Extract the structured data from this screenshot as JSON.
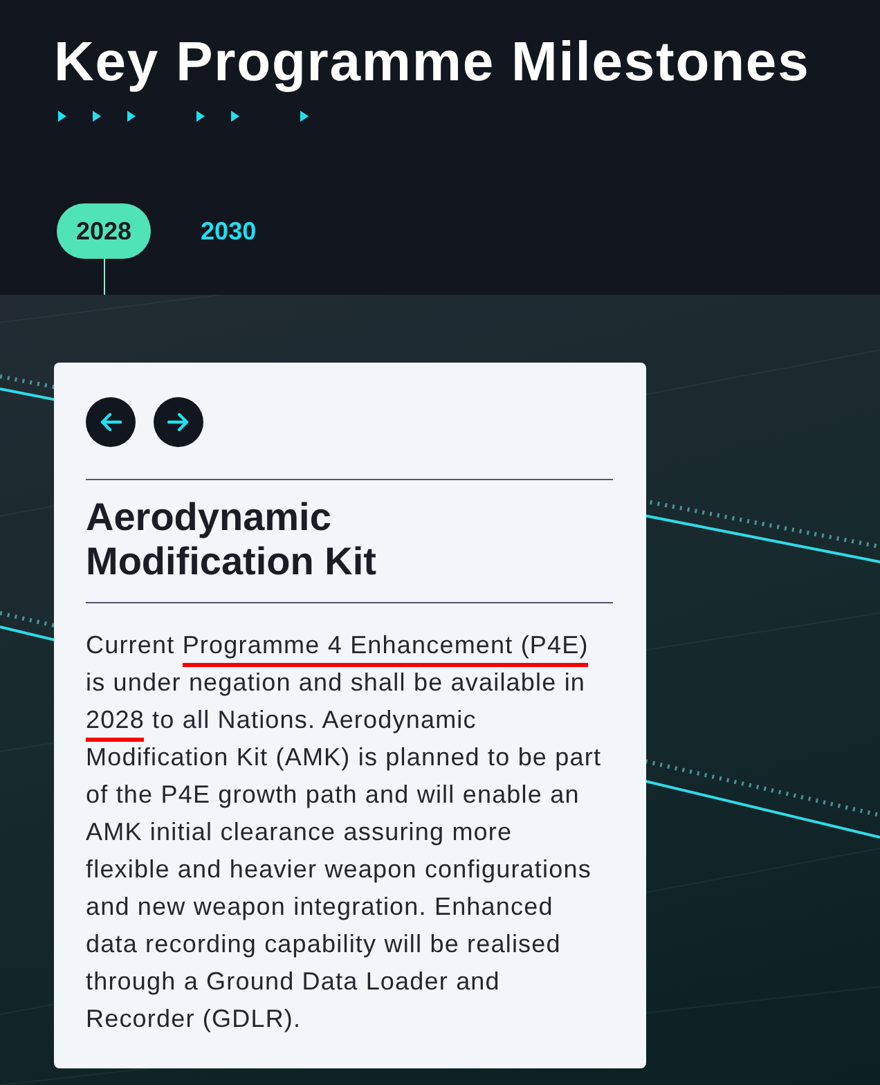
{
  "header": {
    "title": "Key Programme Milestones"
  },
  "timeline": {
    "years": [
      {
        "label": "2028",
        "selected": true
      },
      {
        "label": "2030",
        "selected": false
      }
    ]
  },
  "milestone": {
    "title": "Aerodynamic Modification Kit",
    "description": [
      {
        "text": "Current ",
        "marked": false
      },
      {
        "text": "Programme 4 Enhancement (P4E)",
        "marked": true
      },
      {
        "text": " is under negation and shall be available in ",
        "marked": false
      },
      {
        "text": "2028",
        "marked": true
      },
      {
        "text": " to all Nations. Aerodynamic Modification Kit (AMK) is planned to be part of the P4E growth path and will enable an AMK initial clearance assuring more flexible and heavier weapon configurations and new weapon integration. Enhanced data recording capability will be realised through a Ground Data Loader and Recorder (GDLR).",
        "marked": false
      }
    ]
  }
}
